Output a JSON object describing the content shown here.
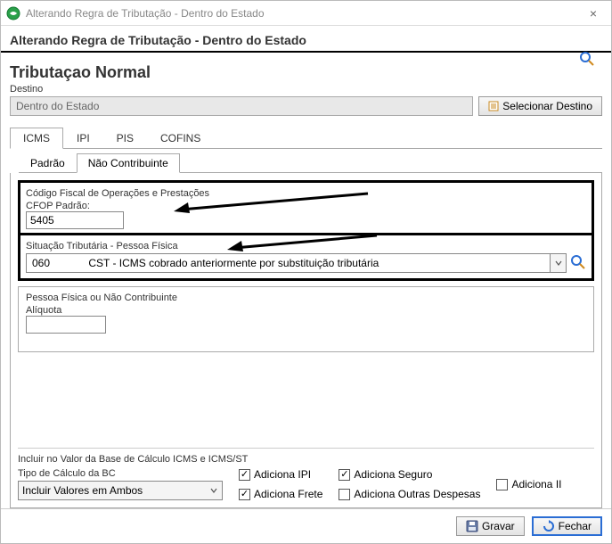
{
  "window": {
    "title": "Alterando Regra de Tributação - Dentro do Estado"
  },
  "header": {
    "title": "Alterando Regra de Tributação - Dentro do Estado"
  },
  "tribute": {
    "section_title": "Tributaçao Normal",
    "dest_label": "Destino",
    "dest_value": "Dentro do Estado",
    "select_dest_btn": "Selecionar Destino"
  },
  "tabs": {
    "icms": "ICMS",
    "ipi": "IPI",
    "pis": "PIS",
    "cofins": "COFINS"
  },
  "subtabs": {
    "padrao": "Padrão",
    "nao_contrib": "Não Contribuinte"
  },
  "cfop": {
    "group_title": "Código Fiscal de Operações e Prestações",
    "label": "CFOP Padrão:",
    "value": "5405"
  },
  "cst": {
    "group_title": "Situação Tributária - Pessoa Física",
    "value": "060             CST - ICMS cobrado anteriormente por substituição tributária"
  },
  "aliq": {
    "group_title": "Pessoa Física ou Não Contribuinte",
    "label": "Alíquota",
    "value": ""
  },
  "bc": {
    "header": "Incluir no Valor da Base de Cálculo ICMS e ICMS/ST",
    "type_label": "Tipo de Cálculo da BC",
    "type_value": "Incluir Valores em Ambos",
    "chk_ipi": "Adiciona IPI",
    "chk_frete": "Adiciona Frete",
    "chk_seguro": "Adiciona Seguro",
    "chk_outras": "Adiciona Outras Despesas",
    "chk_ii": "Adiciona II"
  },
  "buttons": {
    "save": "Gravar",
    "close": "Fechar"
  }
}
